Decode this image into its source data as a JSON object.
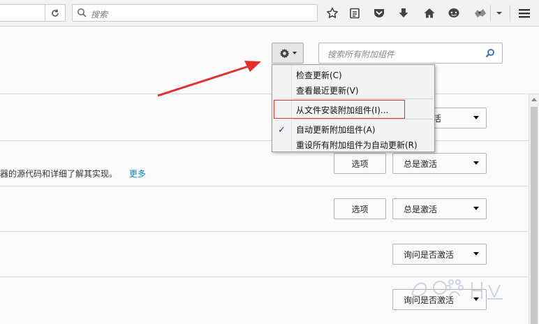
{
  "browser": {
    "search_placeholder": "搜索",
    "icons": [
      "reload-icon",
      "search-icon",
      "bookmark-star-icon",
      "reading-list-icon",
      "pocket-icon",
      "download-icon",
      "home-icon",
      "chat-icon",
      "extension-icon",
      "dropdown-icon",
      "hamburger-menu-icon"
    ]
  },
  "addons": {
    "search_placeholder": "搜索所有附加组件",
    "gear_menu": {
      "items": [
        "检查更新(C)",
        "查看最近更新(V)",
        "从文件安装附加组件(I)...",
        "自动更新附加组件(A)",
        "重设所有附加组件为自动更新(R)"
      ],
      "checked_item": "自动更新附加组件(A)",
      "check_mark": "✓"
    },
    "rows": [
      {
        "select_label": "总是激活",
        "select_label_visible": "活"
      },
      {
        "description": "器的源代码和详细了解其实现。",
        "more_link": "更多",
        "options_label": "选项",
        "select_label": "总是激活"
      },
      {
        "options_label": "选项",
        "select_label": "总是激活"
      },
      {
        "select_label": "询问是否激活"
      },
      {
        "select_label": "询问是否激活"
      }
    ]
  },
  "colors": {
    "link": "#0a84c8",
    "annotation_red": "#e03030",
    "check_blue": "#1b3d9a"
  }
}
